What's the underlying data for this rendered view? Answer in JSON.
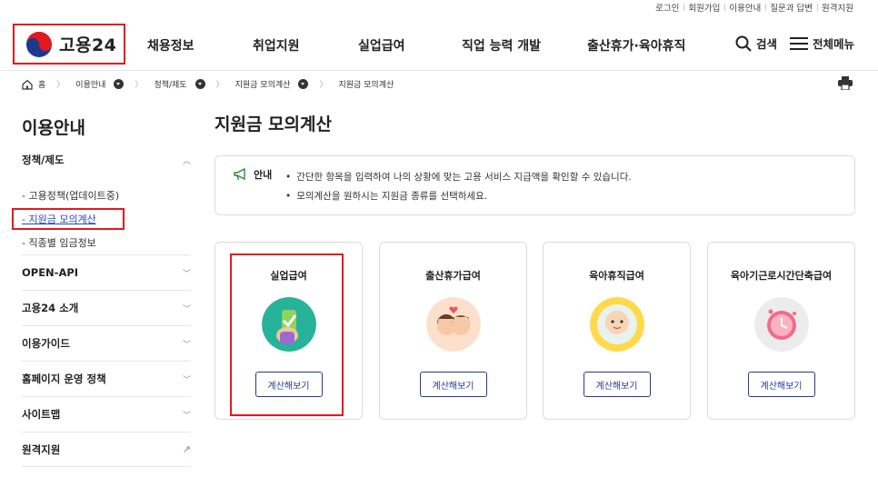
{
  "util_links": [
    "로그인",
    "회원가입",
    "이용안내",
    "질문과 답변",
    "원격지원"
  ],
  "logo": {
    "text": "고용24"
  },
  "gnb": [
    "채용정보",
    "취업지원",
    "실업급여",
    "직업 능력 개발",
    "출산휴가·육아휴직"
  ],
  "header_actions": {
    "search": "검색",
    "menu": "전체메뉴"
  },
  "breadcrumb": [
    "홈",
    "이용안내",
    "정책/제도",
    "지원금 모의계산",
    "지원금 모의계산"
  ],
  "sidebar": {
    "title": "이용안내",
    "group": {
      "label": "정책/제도",
      "items": [
        "고용정책(업데이트중)",
        "지원금 모의계산",
        "직종별 임금정보"
      ]
    },
    "menu": [
      "OPEN-API",
      "고용24 소개",
      "이용가이드",
      "홈페이지 운영 정책",
      "사이트맵",
      "원격지원"
    ]
  },
  "main": {
    "title": "지원금 모의계산",
    "notice": {
      "label": "안내",
      "lines": [
        "간단한 항목을 입력하여 나의 상황에 맞는 고용 서비스 지급액을 확인할 수 있습니다.",
        "모의계산을 원하시는 지원금 종류를 선택하세요."
      ]
    },
    "cards": [
      {
        "title": "실업급여",
        "button": "계산해보기"
      },
      {
        "title": "출산휴가급여",
        "button": "계산해보기"
      },
      {
        "title": "육아휴직급여",
        "button": "계산해보기"
      },
      {
        "title": "육아기근로시간단축급여",
        "button": "계산해보기"
      }
    ]
  },
  "colors": {
    "highlight": "#e4181f",
    "primary": "#223d8f",
    "link": "#2a4ab8"
  }
}
